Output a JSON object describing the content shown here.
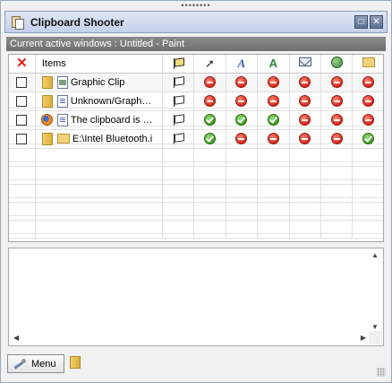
{
  "window": {
    "title": "Clipboard Shooter",
    "minimize": "□",
    "close": "✕"
  },
  "status": {
    "text": "Current active windows : Untitled - Paint"
  },
  "grid": {
    "header": {
      "clear_icon": "✕",
      "items_label": "Items"
    },
    "rows": [
      {
        "checked": false,
        "source_icon": "folder-icon",
        "type_icon": "image-file-icon",
        "label": "Graphic Clip",
        "states": [
          "stop",
          "stop",
          "stop",
          "stop",
          "stop",
          "stop"
        ]
      },
      {
        "checked": false,
        "source_icon": "folder-icon",
        "type_icon": "document-icon",
        "label": "Unknown/Graph…",
        "states": [
          "stop",
          "stop",
          "stop",
          "stop",
          "stop",
          "stop"
        ]
      },
      {
        "checked": false,
        "source_icon": "firefox-icon",
        "type_icon": "text-file-icon",
        "label": "The clipboard is …",
        "states": [
          "ok",
          "ok",
          "ok",
          "stop",
          "stop",
          "stop"
        ]
      },
      {
        "checked": false,
        "source_icon": "folder-icon",
        "type_icon": "folder-icon",
        "label": "E:\\Intel Bluetooth.i",
        "states": [
          "ok",
          "stop",
          "stop",
          "stop",
          "stop",
          "ok"
        ]
      }
    ]
  },
  "bottom": {
    "menu_label": "Menu"
  }
}
